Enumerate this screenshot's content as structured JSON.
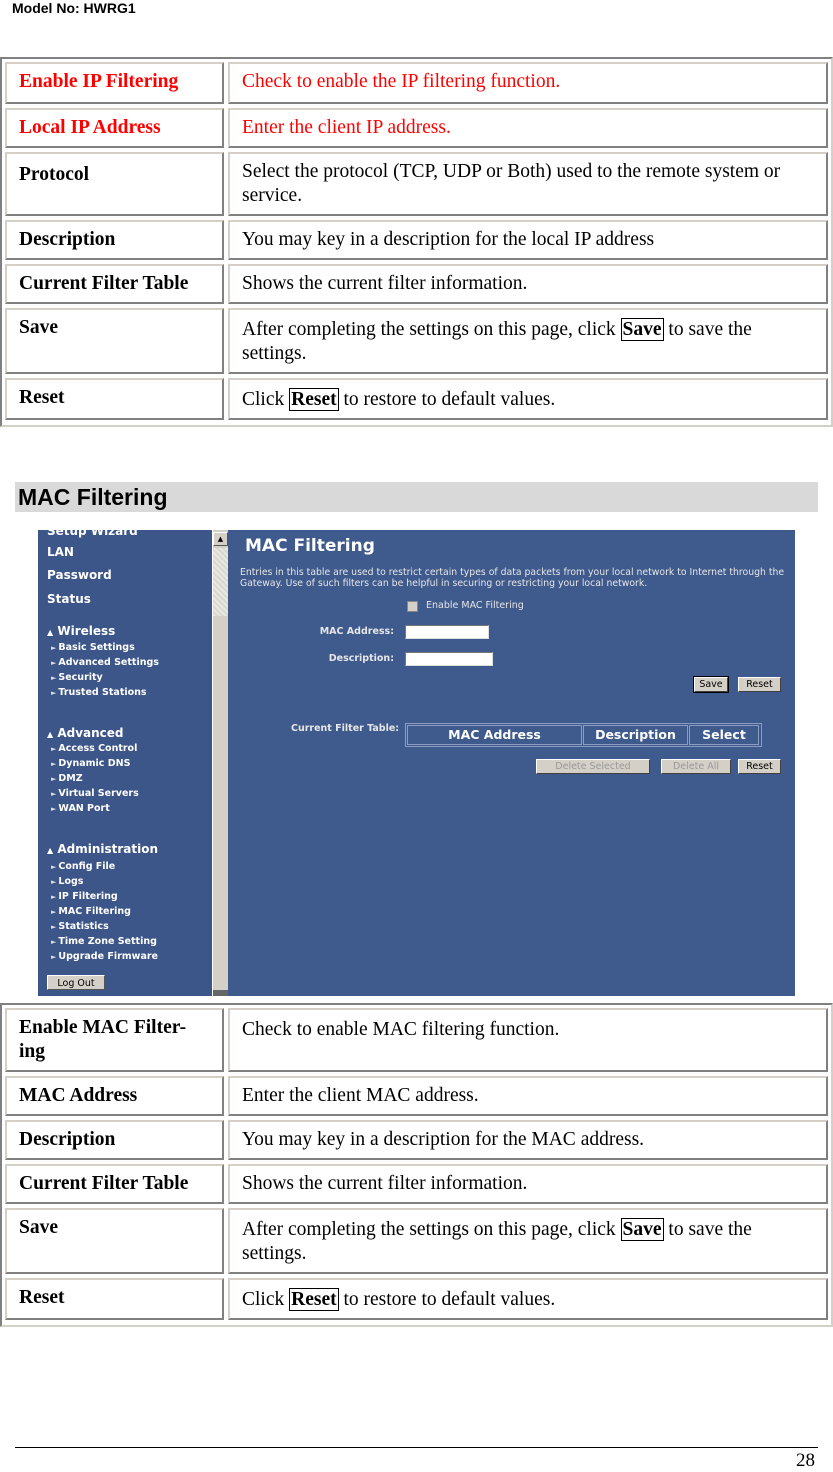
{
  "header": {
    "model": "Model No: HWRG1"
  },
  "ip_table": [
    {
      "term": "Enable IP Filtering",
      "desc": "Check to enable the IP filtering function.",
      "highlight": true
    },
    {
      "term": "Local IP Address",
      "desc": "Enter the client IP address.",
      "highlight": true
    },
    {
      "term": "Protocol",
      "desc": "Select the protocol (TCP, UDP or Both) used to the remote system or service."
    },
    {
      "term": "Description",
      "desc": "You may key in a description for the local IP address"
    },
    {
      "term": "Current Filter Table",
      "desc": "Shows the current filter information."
    },
    {
      "term": "Save",
      "desc_pre": "After completing the settings on this page, click ",
      "desc_key": "Save",
      "desc_post": " to save the settings."
    },
    {
      "term": "Reset",
      "desc_pre": "Click ",
      "desc_key": "Reset",
      "desc_post": " to restore to default values."
    }
  ],
  "section": {
    "title": "MAC Filtering"
  },
  "screenshot": {
    "sidebar": {
      "main_items": [
        "Setup Wizard",
        "LAN",
        "Password",
        "Status"
      ],
      "groups": [
        {
          "label": "Wireless",
          "items": [
            "Basic Settings",
            "Advanced Settings",
            "Security",
            "Trusted Stations"
          ]
        },
        {
          "label": "Advanced",
          "items": [
            "Access Control",
            "Dynamic DNS",
            "DMZ",
            "Virtual Servers",
            "WAN Port"
          ]
        },
        {
          "label": "Administration",
          "items": [
            "Config File",
            "Logs",
            "IP Filtering",
            "MAC Filtering",
            "Statistics",
            "Time Zone Setting",
            "Upgrade Firmware"
          ]
        }
      ],
      "logout": "Log Out"
    },
    "content": {
      "title": "MAC Filtering",
      "intro": "Entries in this table are used to restrict certain types of data packets from your local network to Internet through the Gateway. Use of such filters can be helpful in securing or restricting your local network.",
      "enable_label": "Enable MAC Filtering",
      "mac_label": "MAC Address:",
      "mac_value": "",
      "desc_label": "Description:",
      "desc_value": "",
      "save": "Save",
      "reset": "Reset",
      "cft_label": "Current Filter Table:",
      "columns": [
        "MAC Address",
        "Description",
        "Select"
      ],
      "delete_selected": "Delete Selected",
      "delete_all": "Delete All",
      "reset2": "Reset"
    }
  },
  "mac_table": [
    {
      "term": "Enable MAC Filter-ing",
      "desc": "Check to enable MAC filtering function."
    },
    {
      "term": "MAC Address",
      "desc": "Enter the client MAC address."
    },
    {
      "term": "Description",
      "desc": "You may key in a description for the MAC address."
    },
    {
      "term": "Current Filter Table",
      "desc": "Shows the current filter information."
    },
    {
      "term": "Save",
      "desc_pre": "After completing the settings on this page, click ",
      "desc_key": "Save",
      "desc_post": " to save the settings."
    },
    {
      "term": "Reset",
      "desc_pre": "Click ",
      "desc_key": "Reset",
      "desc_post": " to restore to default values."
    }
  ],
  "footer": {
    "page": "28"
  },
  "colors": {
    "highlight": "#ff0000",
    "panel_blue": "#3f5a8c",
    "heading_bg": "#d9d9d9"
  }
}
